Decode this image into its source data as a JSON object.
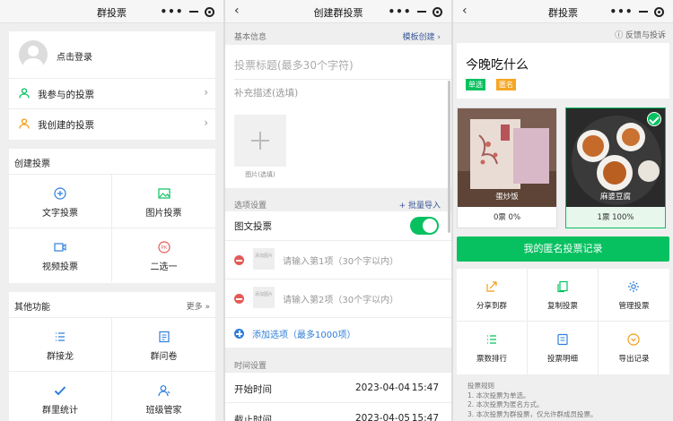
{
  "screen1": {
    "title": "群投票",
    "login": "点击登录",
    "my_participated": "我参与的投票",
    "my_created": "我创建的投票",
    "create_section": "创建投票",
    "create_items": [
      "文字投票",
      "图片投票",
      "视频投票",
      "二选一"
    ],
    "pk_glyph": "PK",
    "other_section": "其他功能",
    "more": "更多 »",
    "other_items": [
      "群接龙",
      "群问卷",
      "群里统计",
      "班级管家"
    ],
    "chevron": "›"
  },
  "screen2": {
    "title": "创建群投票",
    "basic_info": "基本信息",
    "template_import": "模板创建 ›",
    "title_placeholder": "投票标题(最多30个字符)",
    "desc_placeholder": "补充描述(选填)",
    "image_caption": "图片(选填)",
    "option_settings": "选项设置",
    "batch_import": "+ 批量导入",
    "image_text_vote": "图文投票",
    "toggle_on": true,
    "thumb_label": "添加图片",
    "options": [
      "请输入第1项（30个字以内）",
      "请输入第2项（30个字以内）"
    ],
    "add_option": "添加选项（最多1000项）",
    "time_settings": "时间设置",
    "start_label": "开始时间",
    "start_date": "2023-04-04",
    "start_time": "15:47",
    "end_label": "截止时间",
    "end_date": "2023-04-05",
    "end_time": "15:47"
  },
  "screen3": {
    "title": "群投票",
    "feedback": "ⓘ 反馈与投诉",
    "poll_title": "今晚吃什么",
    "tag_single": "单选",
    "tag_anonymous": "匿名",
    "options": [
      {
        "name": "蛋炒饭",
        "votes": "0票 0%",
        "selected": false
      },
      {
        "name": "麻婆豆腐",
        "votes": "1票 100%",
        "selected": true
      }
    ],
    "my_record_button": "我的匿名投票记录",
    "actions": [
      "分享到群",
      "复制投票",
      "管理投票",
      "票数排行",
      "投票明细",
      "导出记录"
    ],
    "rules_title": "投票规则",
    "rules": [
      "1. 本次投票为单选。",
      "2. 本次投票为匿名方式。",
      "3. 本次投票为群投票，仅允许群成员投票。"
    ]
  },
  "colors": {
    "wechat_green": "#07c160",
    "link_blue": "#2f7fd9",
    "tag_orange": "#f5a623",
    "delete_red": "#e45a55"
  },
  "icons": [
    "back-icon",
    "more-dots-icon",
    "minimize-icon",
    "close-record-icon",
    "user-icon",
    "plus-circle-icon",
    "image-icon",
    "video-icon",
    "pk-icon",
    "list-icon",
    "form-icon",
    "check-icon",
    "group-user-icon",
    "share-icon",
    "copy-icon",
    "gear-icon",
    "rank-icon",
    "detail-icon",
    "download-icon"
  ]
}
